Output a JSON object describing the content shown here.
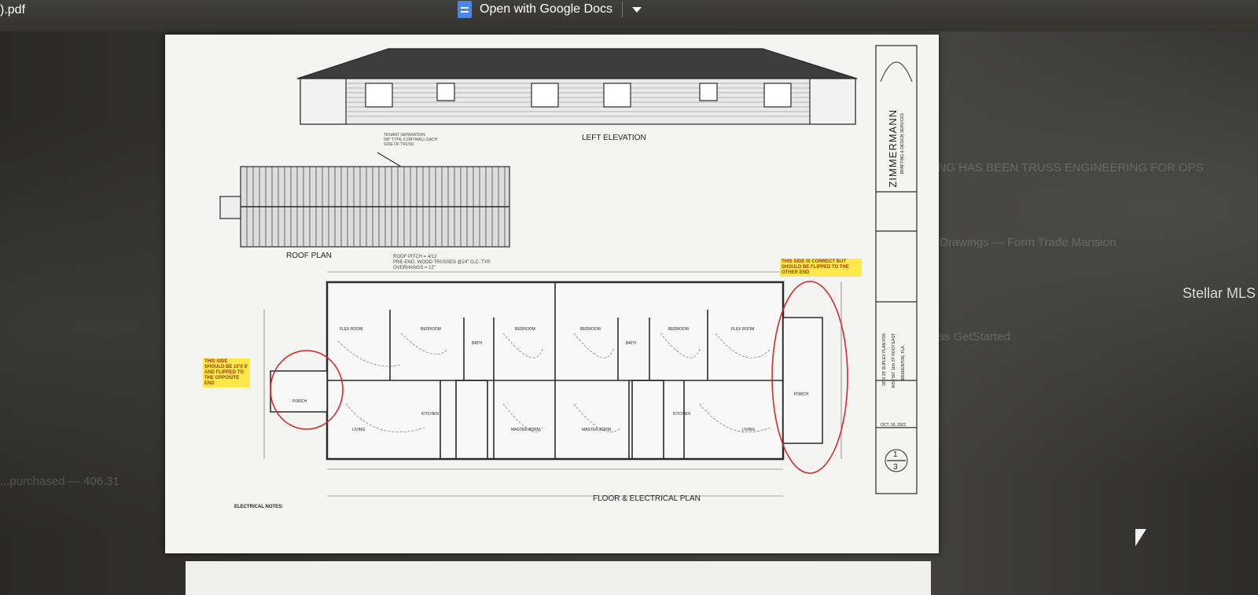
{
  "window": {
    "filename": ").pdf"
  },
  "toolbar": {
    "open_with_label": "Open with Google Docs"
  },
  "sheet": {
    "elevation_title": "LEFT ELEVATION",
    "roof_title": "ROOF PLAN",
    "floor_title": "FLOOR & ELECTRICAL PLAN",
    "tenant_note": "TENANT SEPARATION\n5/8\" TYPE X DRYWALL EACH\nSIDE OF TRUSS",
    "roof_notes": "ROOF PITCH = 4/12\nPRE-ENG. WOOD TRUSSES @24\" O.C. TYP.\nOVERHANGS = 12\"",
    "electrical_notes_title": "ELECTRICAL NOTES:",
    "rooms": [
      "FLEX ROOM",
      "BEDROOM",
      "BATH",
      "BEDROOM",
      "BEDROOM",
      "BATH",
      "BEDROOM",
      "FLEX ROOM",
      "KITCHEN",
      "MASTER BDRM",
      "MASTER BDRM",
      "KITCHEN",
      "LIVING",
      "LIVING",
      "PORCH",
      "PORCH"
    ],
    "highlight_left": "THIS SIDE SHOULD BE 10'X 8' AND FLIPPED TO THE OPPOSITE END",
    "highlight_right": "THIS SIDE IS CORRECT BUT SHOULD BE FLIPPED TO THE OTHER END",
    "title_block": {
      "firm": "ZIMMERMANN",
      "firm_sub": "DRAFTING & DESIGN SERVICES",
      "project": "38' X 29' DUPLEX PLAN FOR",
      "address": "805 / 807 11th ST ROOT EAST",
      "city": "BRADENTON, FLA.",
      "date": "OCT. 16, 2022",
      "sheet_num": "1",
      "sheet_total": "3"
    }
  },
  "watermark": "Stellar MLS",
  "colors": {
    "ink": "#2a2a2a",
    "paper": "#f4f4f2",
    "markup_red": "#d22a2a",
    "highlight": "#ffe94a"
  }
}
